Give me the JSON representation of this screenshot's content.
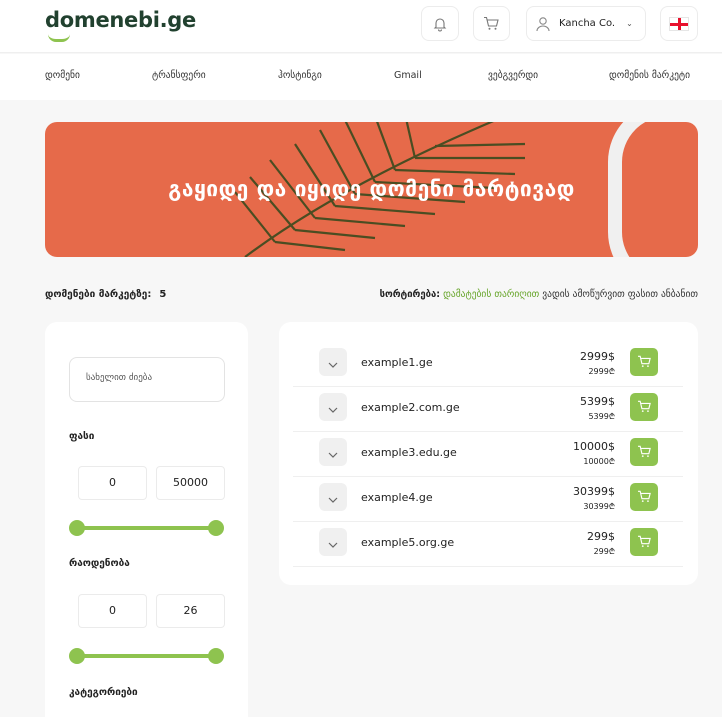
{
  "brand": {
    "logo_text": "domenebi.ge"
  },
  "header": {
    "user_name": "Kancha Co.",
    "icons": {
      "bell": "bell-icon",
      "cart": "cart-icon",
      "user": "user-icon",
      "language": "georgia-flag-icon"
    }
  },
  "nav": {
    "items": [
      "დომენი",
      "ტრანსფერი",
      "ჰოსტინგი",
      "Gmail",
      "ვებგვერდი",
      "დომენის მარკეტი"
    ]
  },
  "hero": {
    "title": "გაყიდე და იყიდე დომენი მარტივად"
  },
  "market": {
    "count_label": "დომენები მარკეტზე:",
    "count_value": "5"
  },
  "sort": {
    "label": "სორტირება:",
    "options": [
      "დამატების თარიღით",
      "ვადის ამოწურვით",
      "ფასით",
      "ანბანით"
    ],
    "active_index": 0,
    "active_color": "#67a52a"
  },
  "filters": {
    "search_placeholder": "სახელით ძიება",
    "price": {
      "title": "ფასი",
      "min": "0",
      "max": "50000"
    },
    "quantity": {
      "title": "რაოდენობა",
      "min": "0",
      "max": "26"
    },
    "categories": {
      "title": "კატეგორიები"
    },
    "accent_color": "#8ec34f"
  },
  "domains": [
    {
      "name": "example1.ge",
      "price_usd": "2999$",
      "price_gel": "2999₾"
    },
    {
      "name": "example2.com.ge",
      "price_usd": "5399$",
      "price_gel": "5399₾"
    },
    {
      "name": "example3.edu.ge",
      "price_usd": "10000$",
      "price_gel": "10000₾"
    },
    {
      "name": "example4.ge",
      "price_usd": "30399$",
      "price_gel": "30399₾"
    },
    {
      "name": "example5.org.ge",
      "price_usd": "299$",
      "price_gel": "299₾"
    }
  ]
}
